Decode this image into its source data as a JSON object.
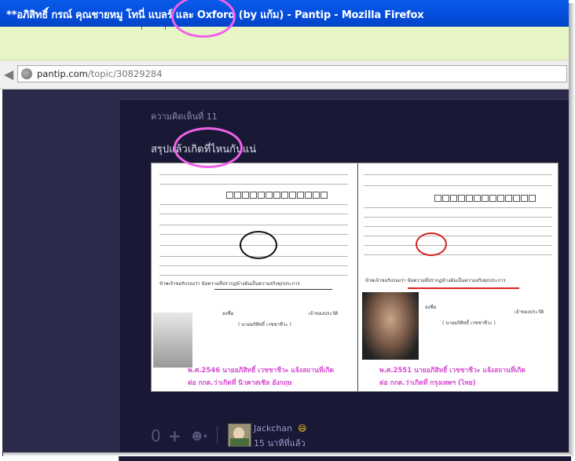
{
  "window": {
    "title": "**อภิสิทธิ์ กรณ์ คุณชายหมู โทนี่ แบลร์ และ Oxford (by แก้ม) - Pantip - Mozilla Firefox"
  },
  "address_bar": {
    "domain": "pantip.com",
    "path": "/topic/30829284"
  },
  "comment": {
    "number_label": "ความคิดเห็นที่ 11",
    "text": "สรุปแล้วเกิดที่ไหนกันแน่",
    "image": {
      "left_caption_line1": "พ.ศ.2546 นายอภิสิทธิ์ เวชชาชีวะ แจ้งสถานที่เกิด",
      "left_caption_line2": "ต่อ กกต.ว่าเกิดที่ นิวคาสเซิล อังกฤษ",
      "right_caption_line1": "พ.ศ.2551 นายอภิสิทธิ์ เวชชาชีวะ แจ้งสถานที่เกิด",
      "right_caption_line2": "ต่อ กกต.ว่าเกิดที่ กรุงเทพฯ (ไทย)",
      "left_doc_line": "ข้าพเจ้าขอรับรองว่า ข้อความที่ปรากฏข้างต้นเป็นความจริงทุกประการ",
      "right_doc_line": "ข้าพเจ้าขอรับรองว่า ข้อความที่ปรากฏข้างต้นเป็นความจริงทุกประการ",
      "left_sign": "ลงชื่อ",
      "left_sign_role": "เจ้าของประวัติ",
      "right_sign": "ลงชื่อ",
      "right_sign_role": "เจ้าของประวัติ",
      "left_signer": "( นายอภิสิทธิ์ เวชชาชีวะ )",
      "right_signer": "( นายอภิสิทธิ์ เวชชาชีวะ )"
    },
    "votes": "0",
    "vote_plus": "+",
    "emotion_icon": "emotion-icon",
    "author": "Jackchan",
    "author_badge": "😄",
    "time_ago": "15 นาทีที่แล้ว"
  },
  "colors": {
    "titlebar": "#0550e0",
    "menuband": "#e8f6c6",
    "page_bg": "#2b2a4a",
    "card_bg": "#191936",
    "annotation": "#f062e8",
    "caption": "#d64ad0"
  }
}
